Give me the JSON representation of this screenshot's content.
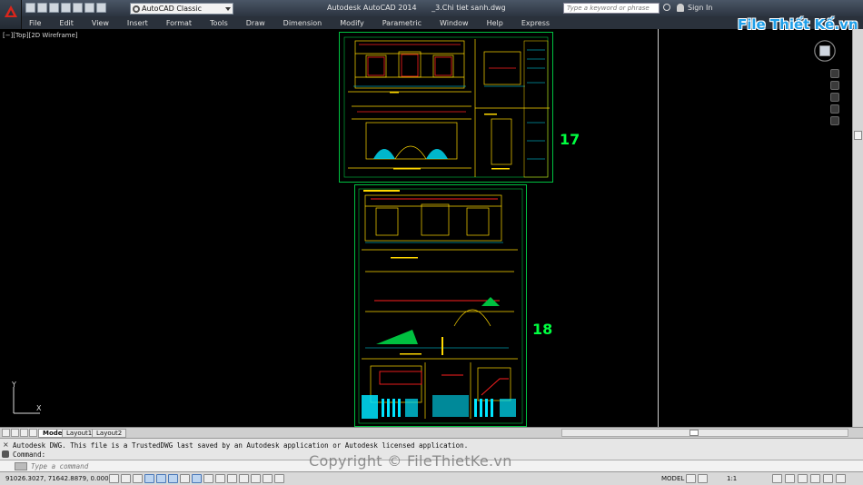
{
  "titlebar": {
    "workspace": "AutoCAD Classic",
    "app_title": "Autodesk AutoCAD 2014",
    "file_name": "_3.Chi tiet sanh.dwg",
    "search_placeholder": "Type a keyword or phrase",
    "signin_label": "Sign In"
  },
  "menu": {
    "items": [
      "File",
      "Edit",
      "View",
      "Insert",
      "Format",
      "Tools",
      "Draw",
      "Dimension",
      "Modify",
      "Parametric",
      "Window",
      "Help",
      "Express"
    ]
  },
  "canvas": {
    "viewport_label": "[−][Top][2D Wireframe]",
    "sheet_17": "17",
    "sheet_18": "18",
    "ucs_x": "X",
    "ucs_y": "Y"
  },
  "tabs": {
    "items": [
      "Model",
      "Layout1",
      "Layout2"
    ],
    "active": "Model"
  },
  "command": {
    "history_line1": "Autodesk DWG.  This file is a TrustedDWG last saved by an Autodesk application or Autodesk licensed application.",
    "history_line2": "Command:",
    "input_placeholder": "Type a command"
  },
  "status": {
    "coordinates": "91026.3027, 71642.8879, 0.0000",
    "model_label": "MODEL",
    "annotation_scale": "1:1"
  },
  "watermark": "Copyright © FileThietKe.vn",
  "site_logo": "File Thiết Kế.vn",
  "colors": {
    "sheet_number": "#00ff40",
    "drawing_yellow": "#ffd800",
    "drawing_red": "#ff2020",
    "drawing_cyan": "#00e5ff",
    "drawing_green": "#00c040"
  }
}
